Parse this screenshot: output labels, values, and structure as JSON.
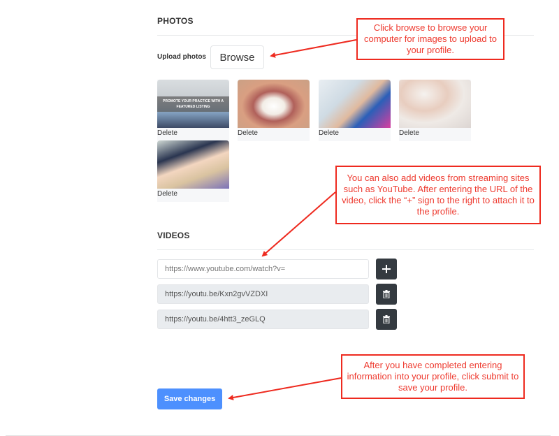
{
  "photos_section": {
    "title": "PHOTOS",
    "upload_label": "Upload photos",
    "browse_label": "Browse",
    "photos": [
      {
        "alt": "promote-practice-banner",
        "overlay_text": "PROMOTE YOUR PRACTICE WITH A FEATURED LISTING",
        "delete_label": "Delete"
      },
      {
        "alt": "smile-closeup",
        "delete_label": "Delete"
      },
      {
        "alt": "patient-dental-chair",
        "delete_label": "Delete"
      },
      {
        "alt": "clear-aligner",
        "delete_label": "Delete"
      },
      {
        "alt": "child-at-dentist",
        "delete_label": "Delete"
      }
    ]
  },
  "videos_section": {
    "title": "VIDEOS",
    "new_video_placeholder": "https://www.youtube.com/watch?v=",
    "videos": [
      {
        "url": "https://youtu.be/Kxn2gvVZDXI"
      },
      {
        "url": "https://youtu.be/4htt3_zeGLQ"
      }
    ],
    "add_icon": "plus-icon",
    "remove_icon": "trash-icon"
  },
  "save_button_label": "Save changes",
  "annotations": {
    "browse_callout": "Click browse to browse your computer for images to upload to your profile.",
    "video_callout": "You can also add videos from streaming sites such as YouTube. After entering the URL of the video, click the “+” sign to the right to attach it to the profile.",
    "save_callout": "After you have completed entering information into your profile, click submit to save your profile.",
    "color": "#ee2a1f"
  },
  "colors": {
    "primary_button": "#4d90fe",
    "dark_button": "#343a40"
  }
}
